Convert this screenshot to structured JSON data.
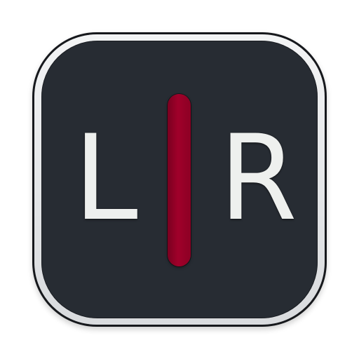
{
  "icon": {
    "left_letter": "L",
    "right_letter": "R",
    "colors": {
      "face": "#272c33",
      "bezel": "#e5e7e9",
      "letters": "#eef0ee",
      "divider": "#9a0028"
    }
  }
}
